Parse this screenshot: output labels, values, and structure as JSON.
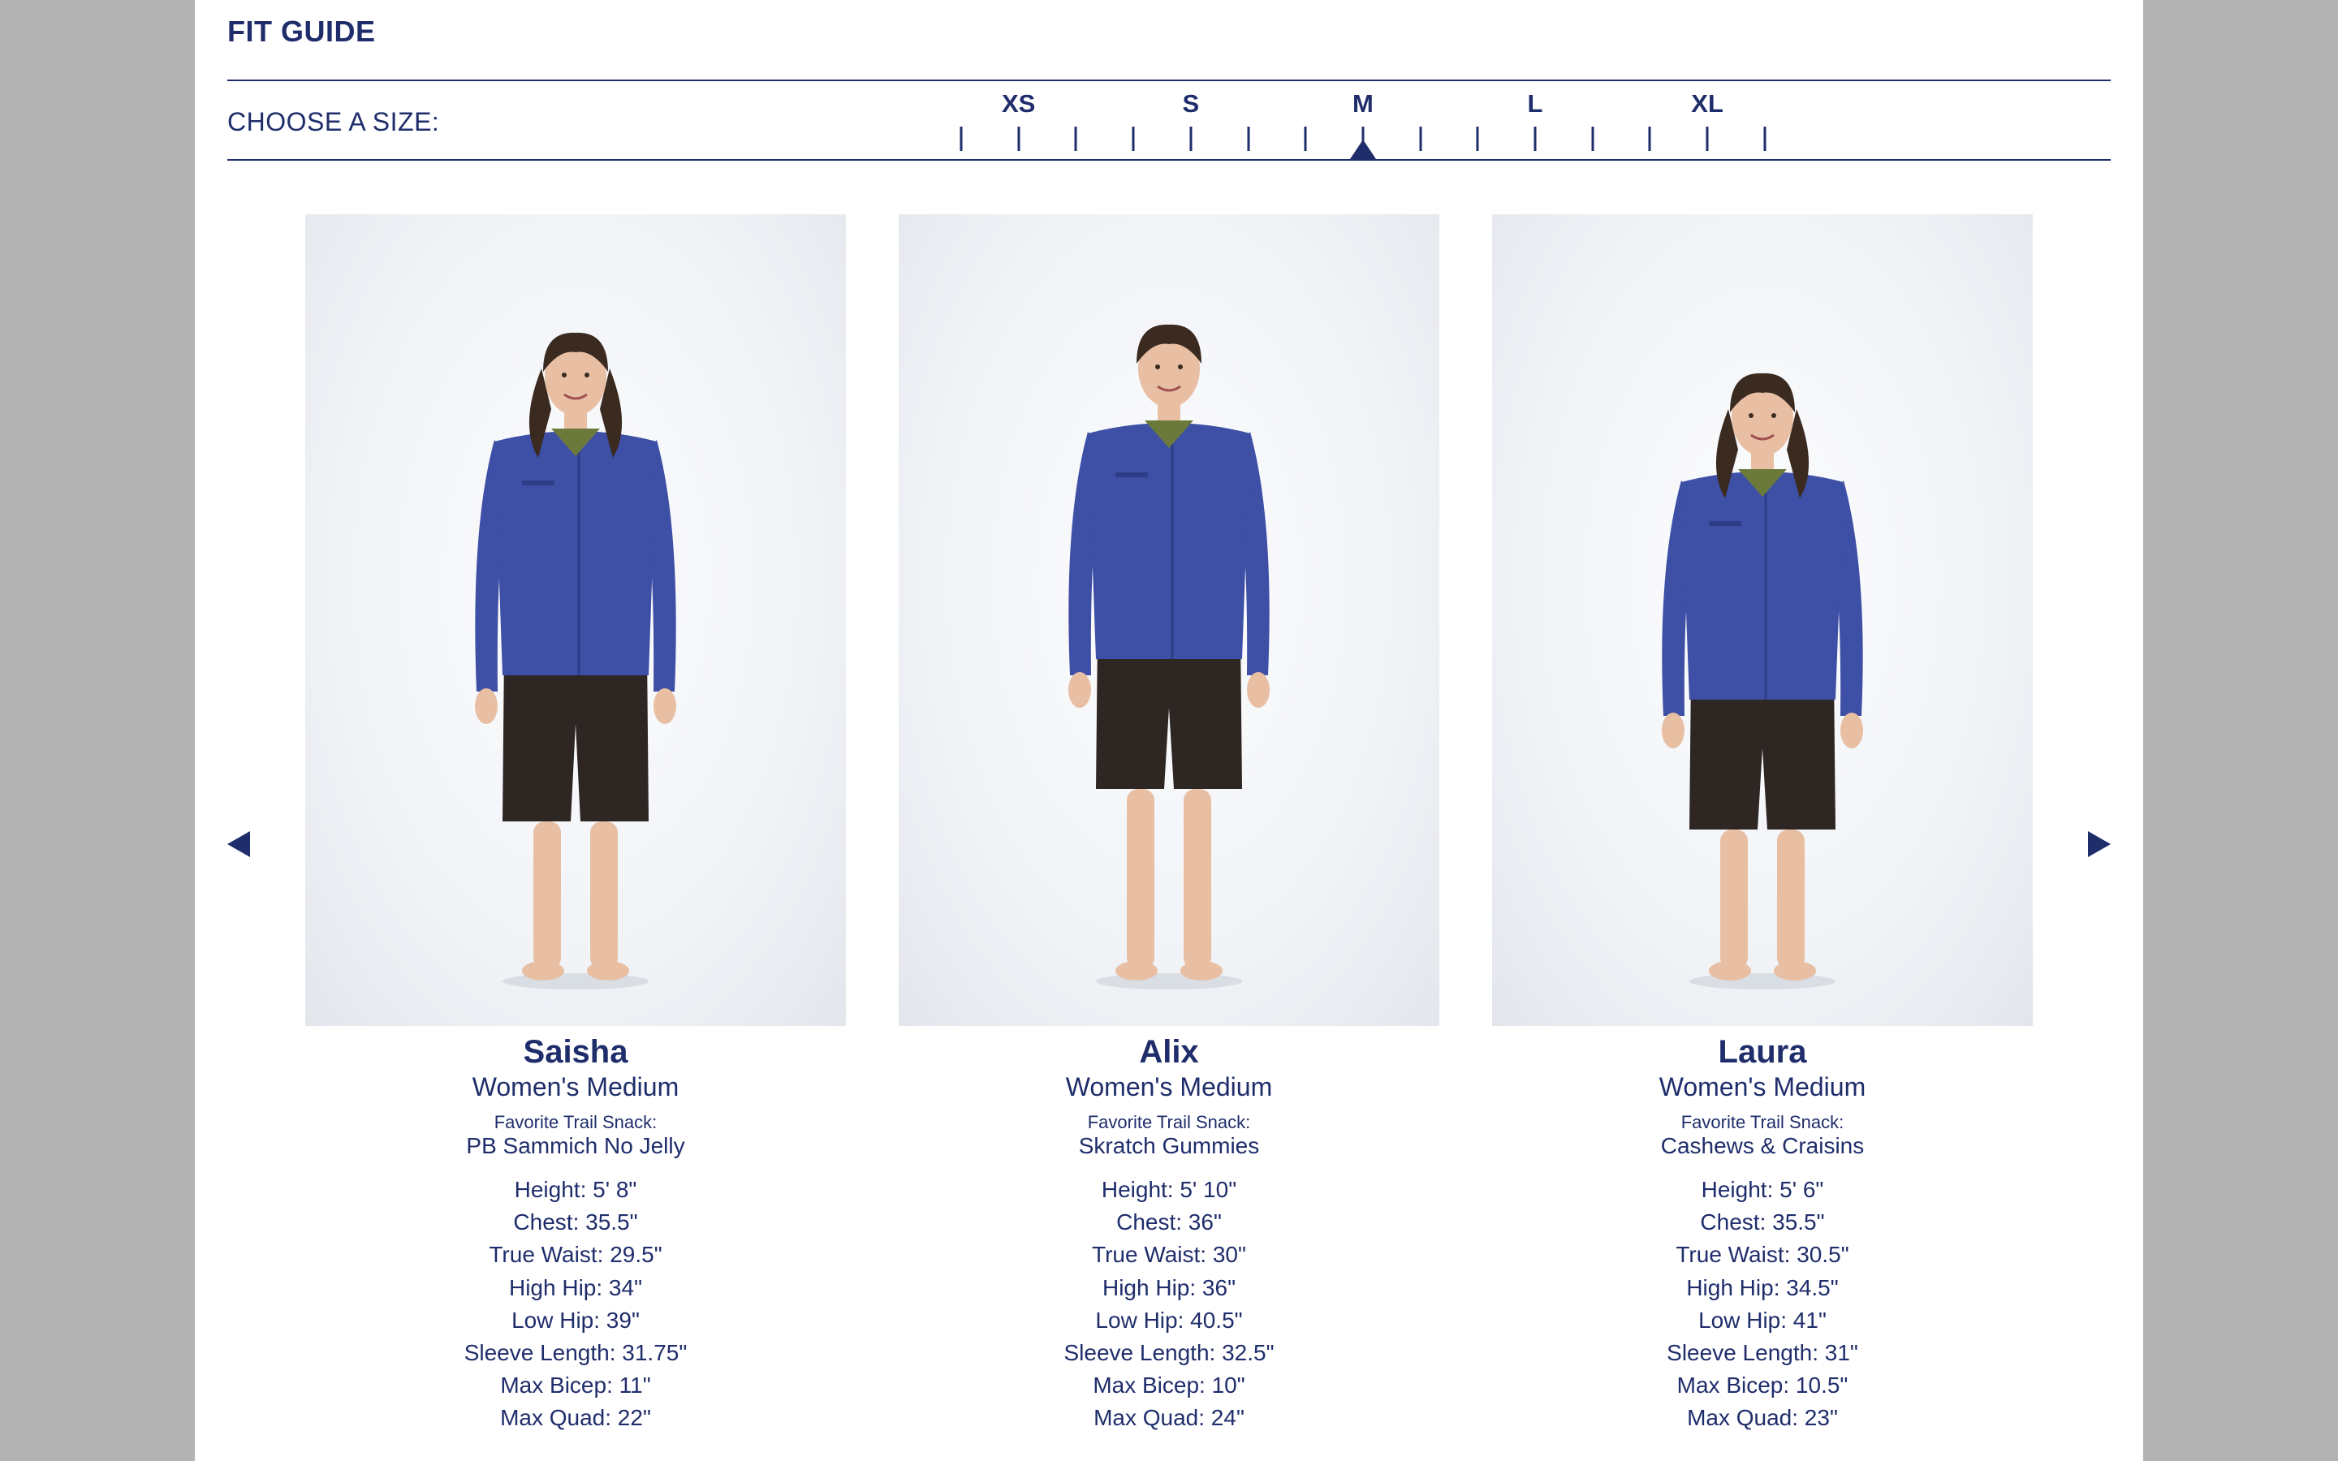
{
  "header": {
    "title": "FIT GUIDE",
    "choose_label": "CHOOSE A SIZE:"
  },
  "size_selector": {
    "labels": [
      "XS",
      "S",
      "M",
      "L",
      "XL"
    ],
    "tick_count": 15,
    "selected": "M"
  },
  "nav": {
    "prev_icon": "triangle-left-icon",
    "next_icon": "triangle-right-icon"
  },
  "colors": {
    "brand_navy": "#1f2d6b",
    "page_background": "#b3b3b3",
    "panel": "#ffffff",
    "jacket_blue": "#3e4fa6",
    "shorts": "#2e2623"
  },
  "models": [
    {
      "name": "Saisha",
      "size": "Women's Medium",
      "snack_label": "Favorite Trail Snack:",
      "snack": "PB Sammich No Jelly",
      "stats": [
        "Height: 5' 8\"",
        "Chest: 35.5\"",
        "True Waist: 29.5\"",
        "High Hip: 34\"",
        "Low Hip: 39\"",
        "Sleeve Length: 31.75\"",
        "Max Bicep: 11\"",
        "Max Quad: 22\""
      ]
    },
    {
      "name": "Alix",
      "size": "Women's Medium",
      "snack_label": "Favorite Trail Snack:",
      "snack": "Skratch Gummies",
      "stats": [
        "Height: 5' 10\"",
        "Chest: 36\"",
        "True Waist: 30\"",
        "High Hip: 36\"",
        "Low Hip: 40.5\"",
        "Sleeve Length: 32.5\"",
        "Max Bicep: 10\"",
        "Max Quad: 24\""
      ]
    },
    {
      "name": "Laura",
      "size": "Women's Medium",
      "snack_label": "Favorite Trail Snack:",
      "snack": "Cashews & Craisins",
      "stats": [
        "Height: 5' 6\"",
        "Chest: 35.5\"",
        "True Waist: 30.5\"",
        "High Hip: 34.5\"",
        "Low Hip: 41\"",
        "Sleeve Length: 31\"",
        "Max Bicep: 10.5\"",
        "Max Quad: 23\""
      ]
    }
  ]
}
